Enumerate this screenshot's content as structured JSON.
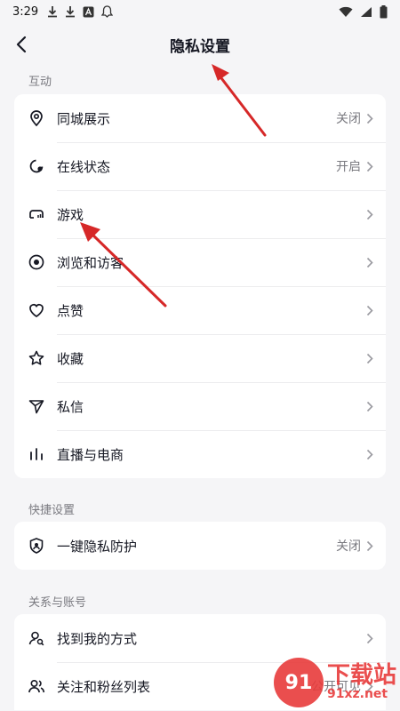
{
  "status_bar": {
    "time": "3:29"
  },
  "nav": {
    "title": "隐私设置"
  },
  "sections": [
    {
      "label": "互动",
      "items": [
        {
          "label": "同城展示",
          "value": "关闭"
        },
        {
          "label": "在线状态",
          "value": "开启"
        },
        {
          "label": "游戏",
          "value": ""
        },
        {
          "label": "浏览和访客",
          "value": ""
        },
        {
          "label": "点赞",
          "value": ""
        },
        {
          "label": "收藏",
          "value": ""
        },
        {
          "label": "私信",
          "value": ""
        },
        {
          "label": "直播与电商",
          "value": ""
        }
      ]
    },
    {
      "label": "快捷设置",
      "items": [
        {
          "label": "一键隐私防护",
          "value": "关闭"
        }
      ]
    },
    {
      "label": "关系与账号",
      "items": [
        {
          "label": "找到我的方式",
          "value": ""
        },
        {
          "label": "关注和粉丝列表",
          "value": "公开可见"
        }
      ]
    }
  ],
  "watermark": {
    "badge": "91",
    "cn": "下载站",
    "en": "91xz.net"
  },
  "colors": {
    "annotation_arrow": "#d62828",
    "background": "#f5f5f7",
    "card": "#ffffff"
  }
}
